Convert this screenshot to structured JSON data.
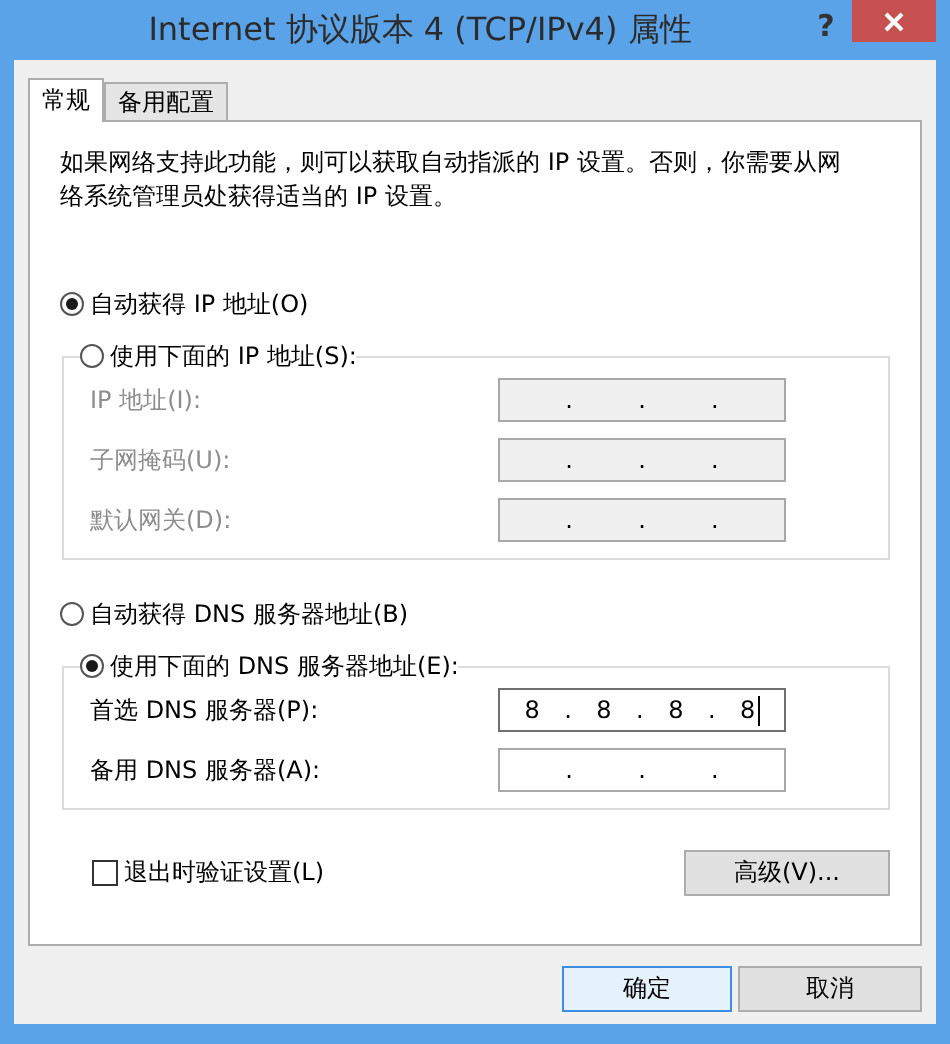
{
  "window": {
    "title": "Internet 协议版本 4 (TCP/IPv4) 属性",
    "help_button": "?"
  },
  "tabs": [
    {
      "label": "常规",
      "selected": true
    },
    {
      "label": "备用配置",
      "selected": false
    }
  ],
  "description": "如果网络支持此功能，则可以获取自动指派的 IP 设置。否则，你需要从网络系统管理员处获得适当的 IP 设置。",
  "ip_group": {
    "options": [
      {
        "label": "自动获得 IP 地址(O)",
        "selected": true
      },
      {
        "label": "使用下面的 IP 地址(S):",
        "selected": false
      }
    ],
    "fields": [
      {
        "label": "IP 地址(I):",
        "disabled": true,
        "focused": false,
        "parts": [
          ".",
          ".",
          "."
        ]
      },
      {
        "label": "子网掩码(U):",
        "disabled": true,
        "focused": false,
        "parts": [
          ".",
          ".",
          "."
        ]
      },
      {
        "label": "默认网关(D):",
        "disabled": true,
        "focused": false,
        "parts": [
          ".",
          ".",
          "."
        ]
      }
    ]
  },
  "dns_group": {
    "options": [
      {
        "label": "自动获得 DNS 服务器地址(B)",
        "selected": false
      },
      {
        "label": "使用下面的 DNS 服务器地址(E):",
        "selected": true
      }
    ],
    "fields": [
      {
        "label": "首选 DNS 服务器(P):",
        "disabled": false,
        "focused": true,
        "parts": [
          "8",
          ".",
          "8",
          ".",
          "8",
          ".",
          "8"
        ]
      },
      {
        "label": "备用 DNS 服务器(A):",
        "disabled": false,
        "focused": false,
        "parts": [
          ".",
          ".",
          "."
        ]
      }
    ]
  },
  "validate_checkbox": {
    "label": "退出时验证设置(L)",
    "checked": false
  },
  "advanced_button": "高级(V)...",
  "buttons": [
    {
      "label": "确定",
      "default": true
    },
    {
      "label": "取消",
      "default": false
    }
  ]
}
